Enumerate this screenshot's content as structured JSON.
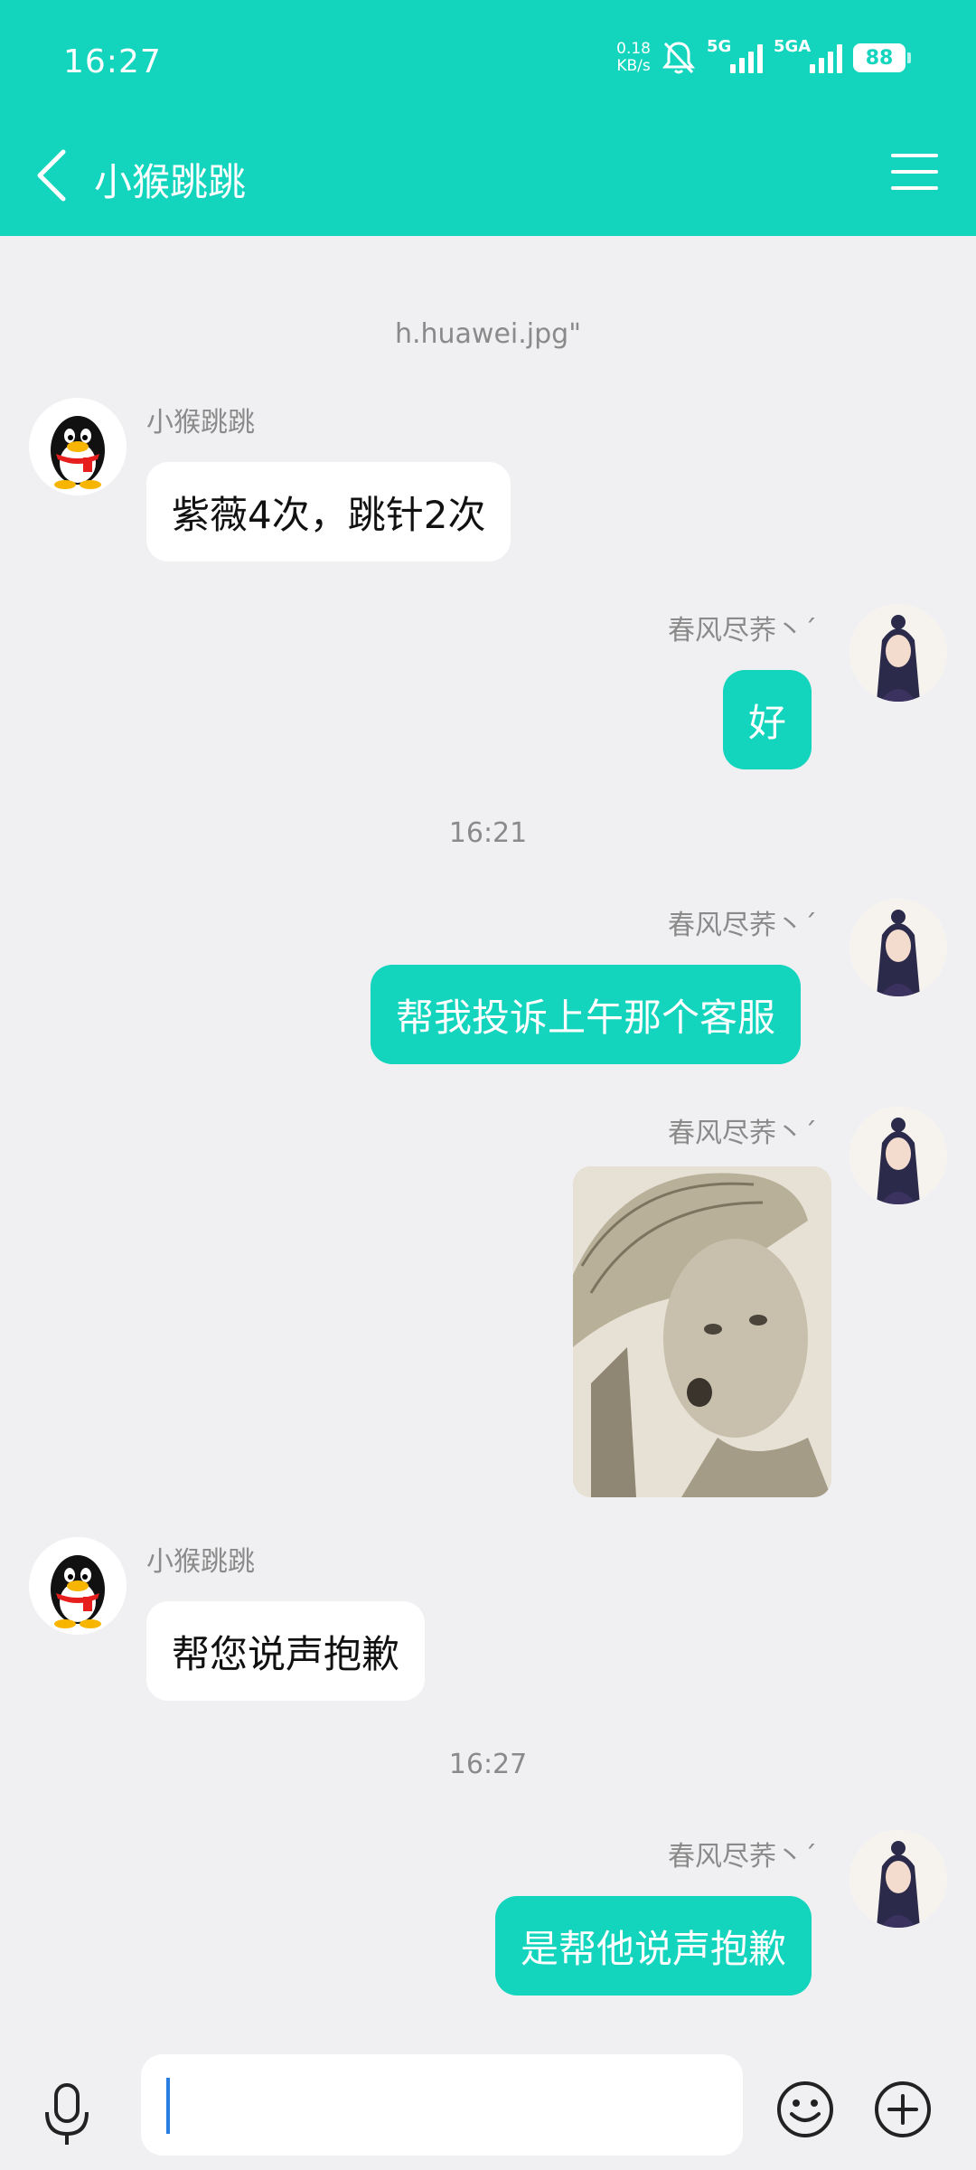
{
  "status": {
    "time": "16:27",
    "net_speed_value": "0.18",
    "net_speed_unit": "KB/s",
    "sig1": "5G",
    "sig2": "5GA",
    "battery": "88"
  },
  "header": {
    "title": "小猴跳跳"
  },
  "messages": {
    "sys_top": "h.huawei.jpg\"",
    "m1_name": "小猴跳跳",
    "m1_text": "紫薇4次，跳针2次",
    "m2_name": "春风尽荞丶´",
    "m2_text": "好",
    "ts1": "16:21",
    "m3_name": "春风尽荞丶´",
    "m3_text": "帮我投诉上午那个客服",
    "m4_name": "春风尽荞丶´",
    "m5_name": "小猴跳跳",
    "m5_text": "帮您说声抱歉",
    "ts2": "16:27",
    "m6_name": "春风尽荞丶´",
    "m6_text": "是帮他说声抱歉"
  },
  "colors": {
    "accent": "#13d4bd",
    "background": "#f0f0f2"
  },
  "icons": [
    "back-icon",
    "menu-icon",
    "mic-icon",
    "emoji-icon",
    "plus-icon",
    "mute-icon"
  ]
}
